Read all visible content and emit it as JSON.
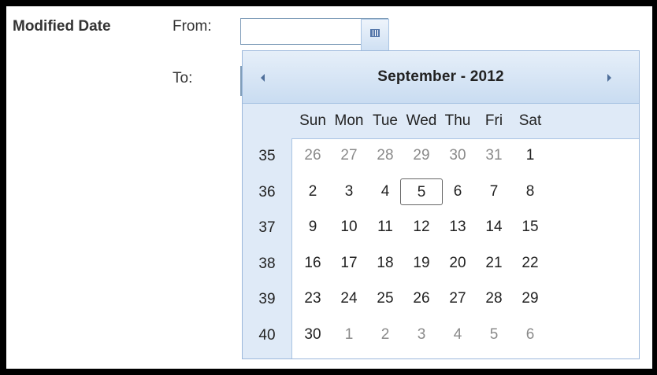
{
  "form": {
    "modified_label": "Modified Date",
    "from_label": "From:",
    "to_label": "To:",
    "from_value": ""
  },
  "calendar": {
    "title": "September - 2012",
    "days_of_week": [
      "Sun",
      "Mon",
      "Tue",
      "Wed",
      "Thu",
      "Fri",
      "Sat"
    ],
    "weeks": [
      {
        "num": "35",
        "days": [
          {
            "d": "26",
            "other": true
          },
          {
            "d": "27",
            "other": true
          },
          {
            "d": "28",
            "other": true
          },
          {
            "d": "29",
            "other": true
          },
          {
            "d": "30",
            "other": true
          },
          {
            "d": "31",
            "other": true
          },
          {
            "d": "1",
            "other": false
          }
        ]
      },
      {
        "num": "36",
        "days": [
          {
            "d": "2",
            "other": false
          },
          {
            "d": "3",
            "other": false
          },
          {
            "d": "4",
            "other": false
          },
          {
            "d": "5",
            "other": false,
            "today": true
          },
          {
            "d": "6",
            "other": false
          },
          {
            "d": "7",
            "other": false
          },
          {
            "d": "8",
            "other": false
          }
        ]
      },
      {
        "num": "37",
        "days": [
          {
            "d": "9",
            "other": false
          },
          {
            "d": "10",
            "other": false
          },
          {
            "d": "11",
            "other": false
          },
          {
            "d": "12",
            "other": false
          },
          {
            "d": "13",
            "other": false
          },
          {
            "d": "14",
            "other": false
          },
          {
            "d": "15",
            "other": false
          }
        ]
      },
      {
        "num": "38",
        "days": [
          {
            "d": "16",
            "other": false
          },
          {
            "d": "17",
            "other": false
          },
          {
            "d": "18",
            "other": false
          },
          {
            "d": "19",
            "other": false
          },
          {
            "d": "20",
            "other": false
          },
          {
            "d": "21",
            "other": false
          },
          {
            "d": "22",
            "other": false
          }
        ]
      },
      {
        "num": "39",
        "days": [
          {
            "d": "23",
            "other": false
          },
          {
            "d": "24",
            "other": false
          },
          {
            "d": "25",
            "other": false
          },
          {
            "d": "26",
            "other": false
          },
          {
            "d": "27",
            "other": false
          },
          {
            "d": "28",
            "other": false
          },
          {
            "d": "29",
            "other": false
          }
        ]
      },
      {
        "num": "40",
        "days": [
          {
            "d": "30",
            "other": false
          },
          {
            "d": "1",
            "other": true
          },
          {
            "d": "2",
            "other": true
          },
          {
            "d": "3",
            "other": true
          },
          {
            "d": "4",
            "other": true
          },
          {
            "d": "5",
            "other": true
          },
          {
            "d": "6",
            "other": true
          }
        ]
      }
    ]
  },
  "icons": {
    "calendar_button": "calendar-icon",
    "prev": "chevron-left-icon",
    "next": "chevron-right-icon"
  },
  "colors": {
    "header_bg": "#c9dcf1",
    "panel_bg": "#dfeaf7",
    "border": "#9bb7db",
    "other_month_text": "#8a8a8a"
  }
}
